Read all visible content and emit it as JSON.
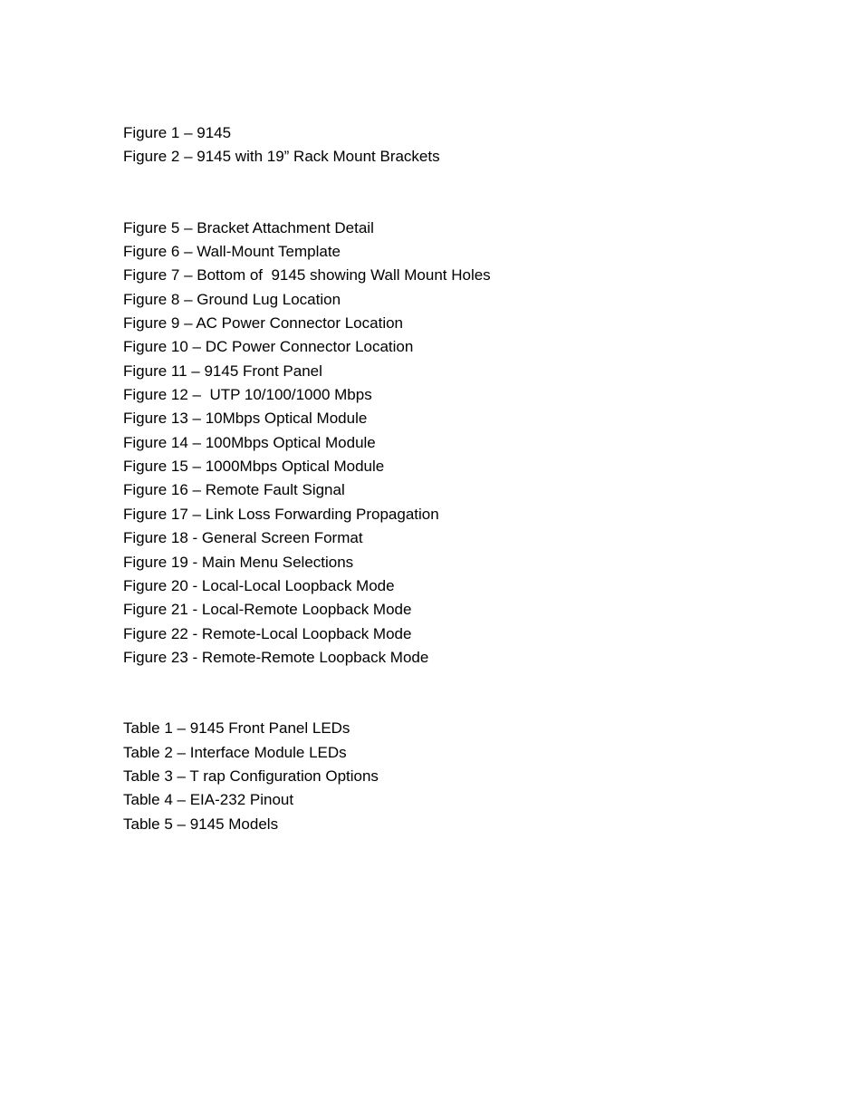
{
  "figures_a": [
    "Figure 1 – 9145",
    "Figure 2 – 9145 with 19” Rack Mount Brackets"
  ],
  "figures_b": [
    "Figure 5 – Bracket Attachment Detail",
    "Figure 6 – Wall-Mount Template",
    "Figure 7 – Bottom of  9145 showing Wall Mount Holes",
    "Figure 8 – Ground Lug Location",
    "Figure 9 – AC Power Connector Location",
    "Figure 10 – DC Power Connector Location",
    "Figure 11 – 9145 Front Panel",
    "Figure 12 –  UTP 10/100/1000 Mbps",
    "Figure 13 – 10Mbps Optical Module",
    "Figure 14 – 100Mbps Optical Module",
    "Figure 15 – 1000Mbps Optical Module",
    "Figure 16 – Remote Fault Signal",
    "Figure 17 – Link Loss Forwarding Propagation",
    "Figure 18 - General Screen Format",
    "Figure 19 - Main Menu Selections",
    "Figure 20 - Local-Local Loopback Mode",
    "Figure 21 - Local-Remote Loopback Mode",
    "Figure 22 - Remote-Local Loopback Mode",
    "Figure 23 - Remote-Remote Loopback Mode"
  ],
  "tables": [
    "Table 1 – 9145 Front Panel LEDs",
    "Table 2 – Interface Module LEDs",
    "Table 3 – T rap Configuration Options",
    "Table 4 – EIA-232 Pinout",
    "Table 5 – 9145 Models"
  ]
}
